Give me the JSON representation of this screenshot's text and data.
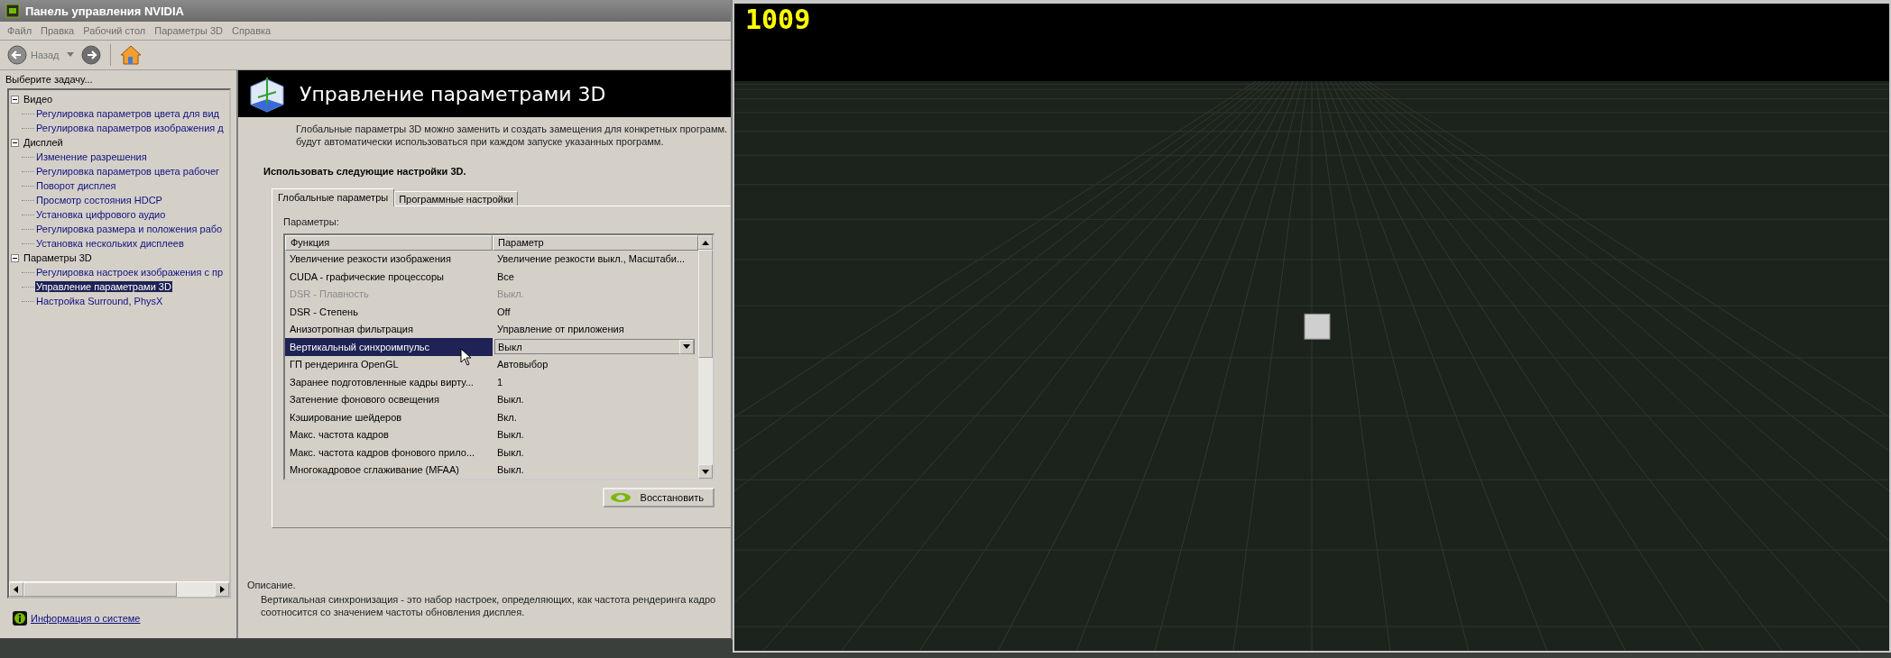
{
  "window": {
    "title": "Панель управления NVIDIA"
  },
  "menu": [
    "Файл",
    "Правка",
    "Рабочий стол",
    "Параметры 3D",
    "Справка"
  ],
  "toolbar": {
    "back_label": "Назад"
  },
  "task_pane": {
    "title": "Выберите задачу...",
    "tree": [
      {
        "label": "Видео",
        "expanded": true,
        "selected": false,
        "children": [
          {
            "label": "Регулировка параметров цвета для вид",
            "selected": false
          },
          {
            "label": "Регулировка параметров изображения д",
            "selected": false
          }
        ]
      },
      {
        "label": "Дисплей",
        "expanded": true,
        "selected": false,
        "children": [
          {
            "label": "Изменение разрешения",
            "selected": false
          },
          {
            "label": "Регулировка параметров цвета рабочег",
            "selected": false
          },
          {
            "label": "Поворот дисплея",
            "selected": false
          },
          {
            "label": "Просмотр состояния HDCP",
            "selected": false
          },
          {
            "label": "Установка цифрового аудио",
            "selected": false
          },
          {
            "label": "Регулировка размера и положения рабо",
            "selected": false
          },
          {
            "label": "Установка нескольких дисплеев",
            "selected": false
          }
        ]
      },
      {
        "label": "Параметры 3D",
        "expanded": true,
        "selected": false,
        "children": [
          {
            "label": "Регулировка настроек изображения с пр",
            "selected": false
          },
          {
            "label": "Управление параметрами 3D",
            "selected": true
          },
          {
            "label": "Настройка Surround, PhysX",
            "selected": false
          }
        ]
      }
    ],
    "footer_link": "Информация о системе"
  },
  "page": {
    "title": "Управление параметрами 3D",
    "intro": [
      "Глобальные параметры 3D можно заменить и создать замещения для конкретных программ.",
      "будут автоматически использоваться при каждом запуске указанных программ."
    ],
    "section_title": "Использовать следующие настройки 3D.",
    "tabs": [
      {
        "label": "Глобальные параметры",
        "selected": true
      },
      {
        "label": "Программные настройки",
        "selected": false
      }
    ],
    "params_label": "Параметры:",
    "table": {
      "columns": [
        "Функция",
        "Параметр"
      ],
      "rows": [
        {
          "function": "Увеличение резкости изображения",
          "value": "Увеличение резкости выкл., Масштаби...",
          "disabled": false,
          "selected": false
        },
        {
          "function": "CUDA - графические процессоры",
          "value": "Все",
          "disabled": false,
          "selected": false
        },
        {
          "function": "DSR - Плавность",
          "value": "Выкл.",
          "disabled": true,
          "selected": false
        },
        {
          "function": "DSR - Степень",
          "value": "Off",
          "disabled": false,
          "selected": false
        },
        {
          "function": "Анизотропная фильтрация",
          "value": "Управление от приложения",
          "disabled": false,
          "selected": false
        },
        {
          "function": "Вертикальный синхроимпульс",
          "value": "Выкл",
          "disabled": false,
          "selected": true
        },
        {
          "function": "ГП рендеринга OpenGL",
          "value": "Автовыбор",
          "disabled": false,
          "selected": false
        },
        {
          "function": "Заранее подготовленные кадры вирту...",
          "value": "1",
          "disabled": false,
          "selected": false
        },
        {
          "function": "Затенение фонового освещения",
          "value": "Выкл.",
          "disabled": false,
          "selected": false
        },
        {
          "function": "Кэширование шейдеров",
          "value": "Вкл.",
          "disabled": false,
          "selected": false
        },
        {
          "function": "Макс. частота кадров",
          "value": "Выкл.",
          "disabled": false,
          "selected": false
        },
        {
          "function": "Макс. частота кадров фонового прило...",
          "value": "Выкл.",
          "disabled": false,
          "selected": false
        },
        {
          "function": "Многокадровое сглаживание (MFAA)",
          "value": "Выкл.",
          "disabled": false,
          "selected": false
        }
      ]
    },
    "restore_button": "Восстановить",
    "description_title": "Описание.",
    "description": [
      "Вертикальная синхронизация - это набор настроек, определяющих, как частота рендеринга кадро",
      "соотносится со значением частоты обновления дисплея."
    ]
  },
  "render_view": {
    "counter": "1009"
  }
}
